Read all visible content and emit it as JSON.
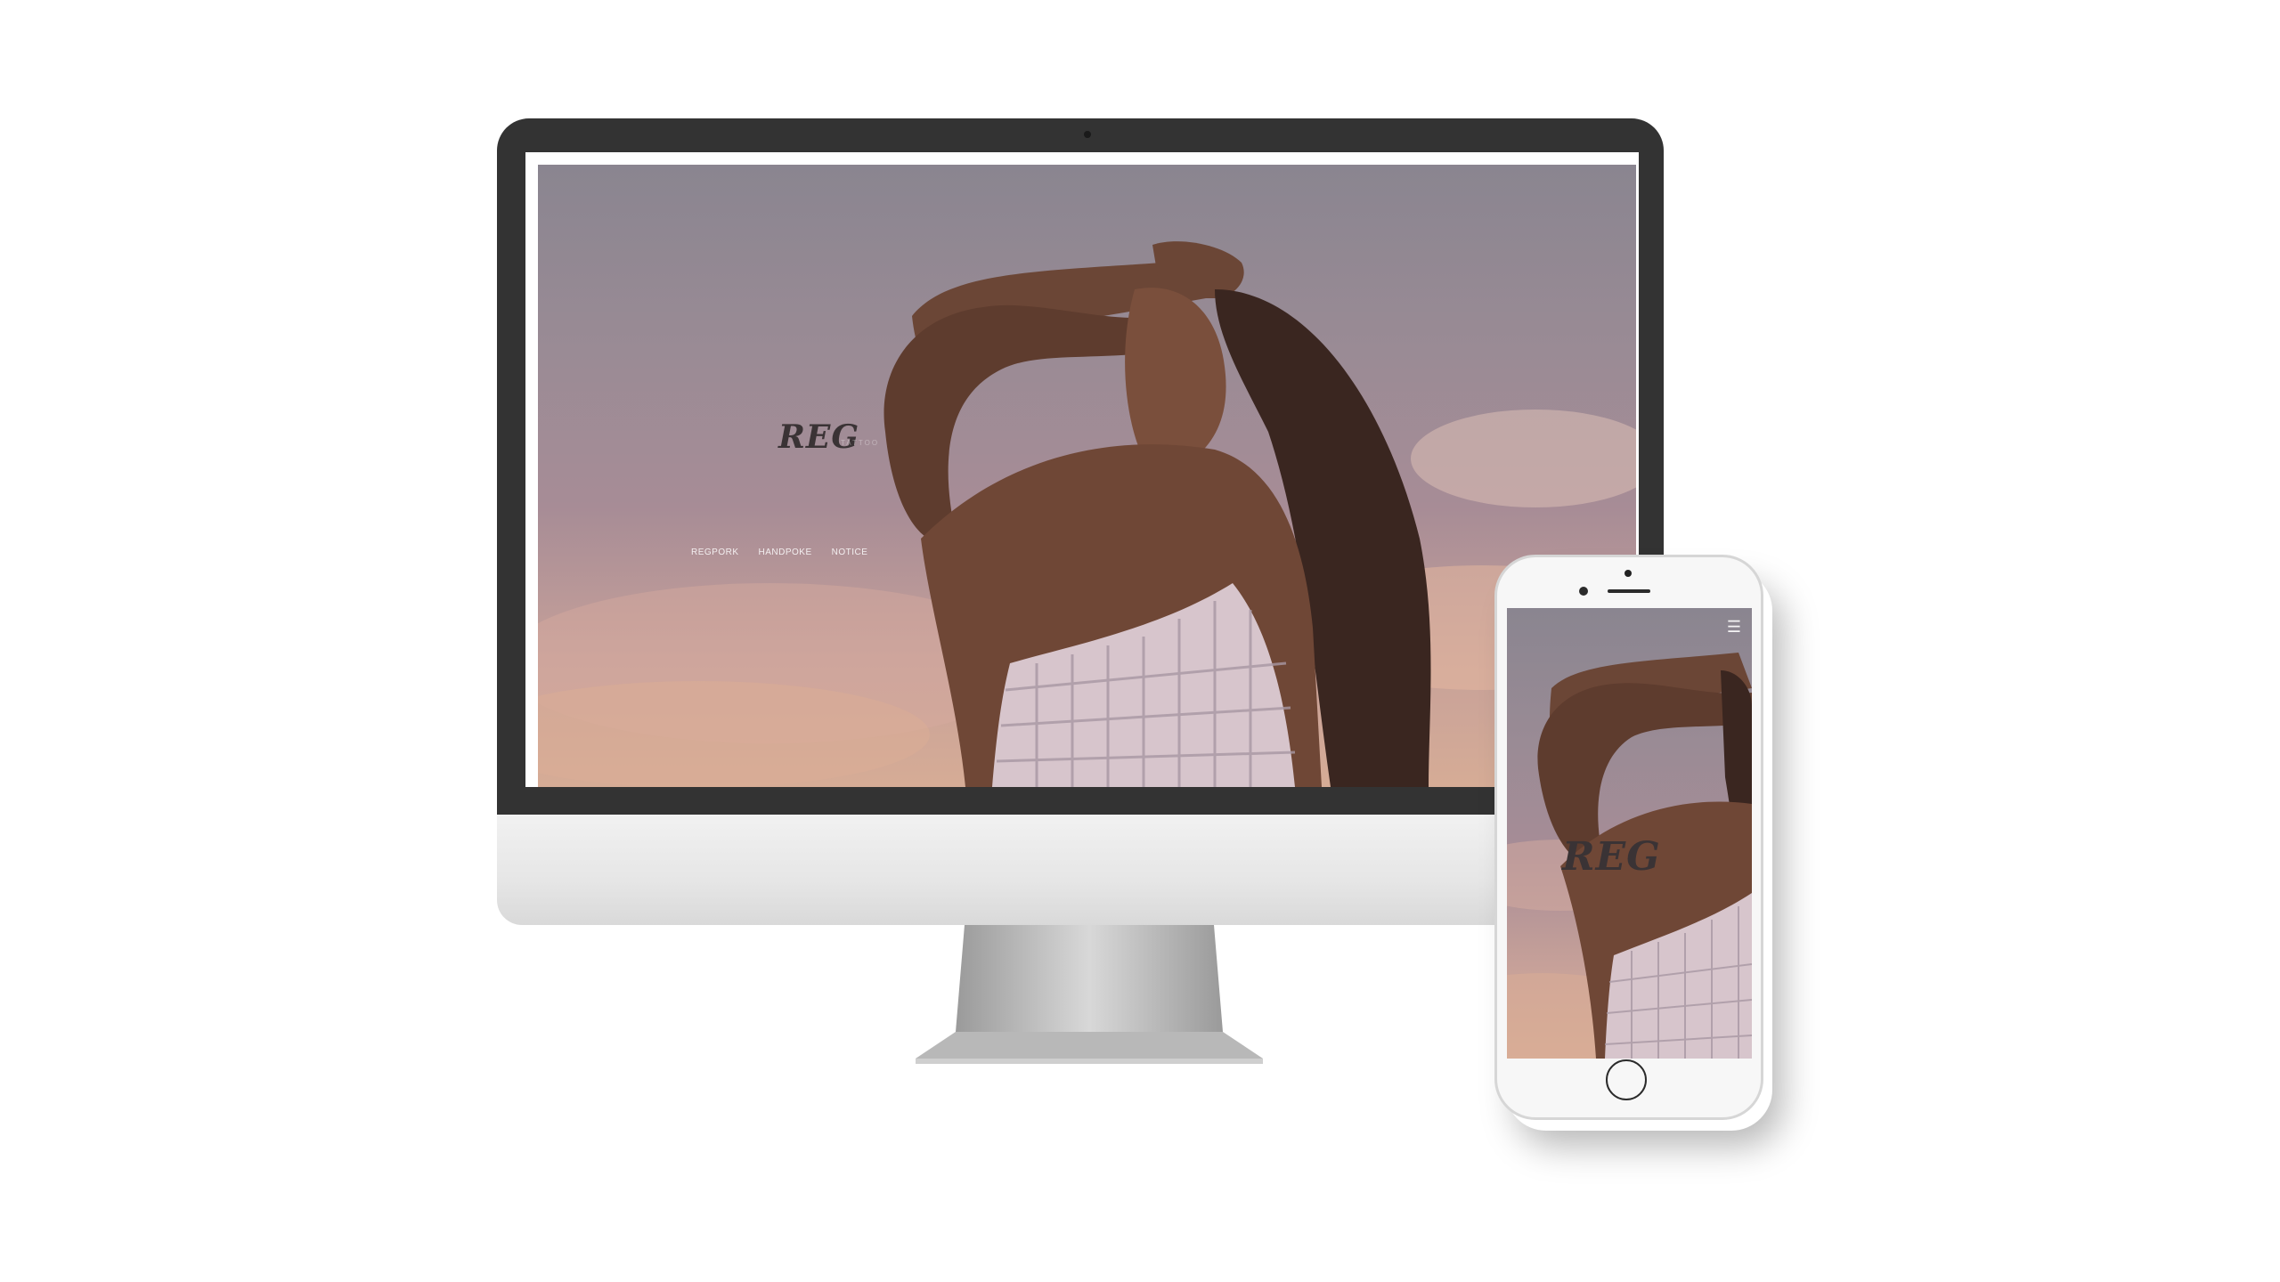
{
  "desktop_site": {
    "logo": "REG",
    "logo_sub": "TATTOO",
    "nav": [
      "REGPORK",
      "HANDPOKE",
      "NOTICE"
    ]
  },
  "mobile_site": {
    "logo": "REG",
    "menu_icon": "hamburger-menu-icon"
  },
  "colors": {
    "bezel": "#333333",
    "sky_top": "#8a8590",
    "sky_bottom": "#d6ac96",
    "logo": "#3a3335"
  }
}
